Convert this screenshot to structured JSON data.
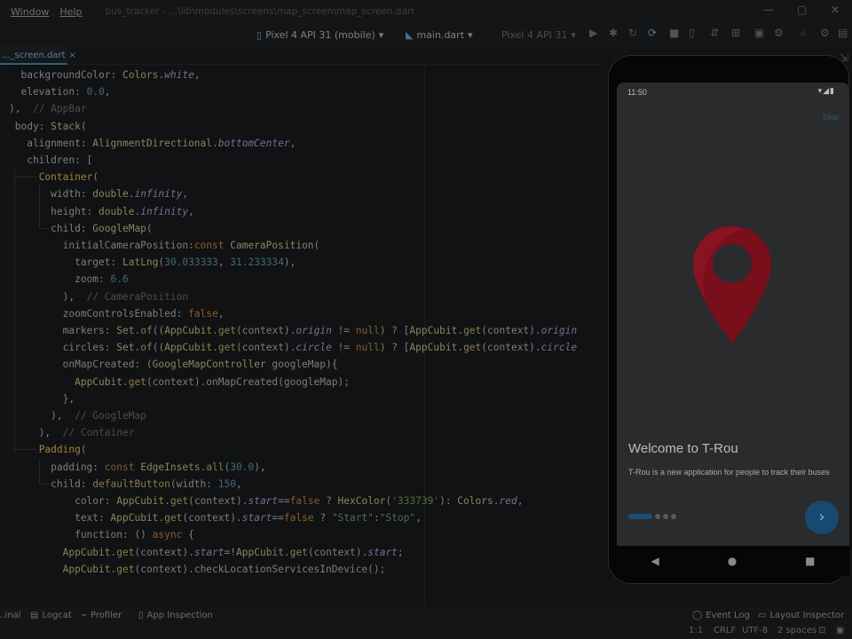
{
  "menu": {
    "window": "Window",
    "help": "Help",
    "path": "bus_tracker - ...\\lib\\modules\\screens\\map_screen\\map_screen.dart"
  },
  "toolbar": {
    "device": "Pixel 4 API 31 (mobile)",
    "config": "main.dart",
    "device2": "Pixel 4 API 31"
  },
  "tab": {
    "name": "..._screen.dart"
  },
  "code": [
    [
      [
        "t",
        "  backgroundColor: "
      ],
      [
        "cl",
        "Colors"
      ],
      [
        "t",
        "."
      ],
      [
        "pr",
        "white"
      ],
      [
        "t",
        ","
      ]
    ],
    [
      [
        "t",
        "  elevation: "
      ],
      [
        "nm",
        "0.0"
      ],
      [
        "t",
        ","
      ]
    ],
    [
      [
        "t",
        "),  "
      ],
      [
        "cm",
        "// AppBar"
      ]
    ],
    [
      [
        "t",
        " body: "
      ],
      [
        "cl",
        "Stack"
      ],
      [
        "t",
        "("
      ]
    ],
    [
      [
        "t",
        "   alignment: "
      ],
      [
        "cl",
        "AlignmentDirectional"
      ],
      [
        "t",
        "."
      ],
      [
        "pr",
        "bottomCenter"
      ],
      [
        "t",
        ","
      ]
    ],
    [
      [
        "t",
        "   children: ["
      ]
    ],
    [
      [
        "t",
        "     "
      ],
      [
        "tag",
        "Container"
      ],
      [
        "t",
        "("
      ]
    ],
    [
      [
        "t",
        "       width: "
      ],
      [
        "cl",
        "double"
      ],
      [
        "t",
        "."
      ],
      [
        "pr",
        "infinity"
      ],
      [
        "t",
        ","
      ]
    ],
    [
      [
        "t",
        "       height: "
      ],
      [
        "cl",
        "double"
      ],
      [
        "t",
        "."
      ],
      [
        "pr",
        "infinity"
      ],
      [
        "t",
        ","
      ]
    ],
    [
      [
        "t",
        "       child: "
      ],
      [
        "cl",
        "GoogleMap"
      ],
      [
        "t",
        "("
      ]
    ],
    [
      [
        "t",
        "         initialCameraPosition:"
      ],
      [
        "kw",
        "const "
      ],
      [
        "cl",
        "CameraPosition"
      ],
      [
        "t",
        "("
      ]
    ],
    [
      [
        "t",
        "           target: "
      ],
      [
        "cl",
        "LatLng"
      ],
      [
        "t",
        "("
      ],
      [
        "nm",
        "30.033333"
      ],
      [
        "t",
        ", "
      ],
      [
        "nm",
        "31.233334"
      ],
      [
        "t",
        "),"
      ]
    ],
    [
      [
        "t",
        "           zoom: "
      ],
      [
        "nm",
        "6.6"
      ]
    ],
    [
      [
        "t",
        "         ),  "
      ],
      [
        "cm",
        "// CameraPosition"
      ]
    ],
    [
      [
        "t",
        "         zoomControlsEnabled: "
      ],
      [
        "kw",
        "false"
      ],
      [
        "t",
        ","
      ]
    ],
    [
      [
        "t",
        "         markers: "
      ],
      [
        "cl",
        "Set"
      ],
      [
        "t",
        "."
      ],
      [
        "fn",
        "of"
      ],
      [
        "t",
        "(("
      ],
      [
        "cl",
        "AppCubit"
      ],
      [
        "t",
        "."
      ],
      [
        "fn",
        "get"
      ],
      [
        "t",
        "(context)."
      ],
      [
        "pr",
        "origin"
      ],
      [
        "t",
        " != "
      ],
      [
        "kw",
        "null"
      ],
      [
        "t",
        ") ? ["
      ],
      [
        "cl",
        "AppCubit"
      ],
      [
        "t",
        "."
      ],
      [
        "fn",
        "get"
      ],
      [
        "t",
        "(context)."
      ],
      [
        "pr",
        "origin"
      ]
    ],
    [
      [
        "t",
        "         circles: "
      ],
      [
        "cl",
        "Set"
      ],
      [
        "t",
        "."
      ],
      [
        "fn",
        "of"
      ],
      [
        "t",
        "(("
      ],
      [
        "cl",
        "AppCubit"
      ],
      [
        "t",
        "."
      ],
      [
        "fn",
        "get"
      ],
      [
        "t",
        "(context)."
      ],
      [
        "pr",
        "circle"
      ],
      [
        "t",
        " != "
      ],
      [
        "kw",
        "null"
      ],
      [
        "t",
        ") ? ["
      ],
      [
        "cl",
        "AppCubit"
      ],
      [
        "t",
        "."
      ],
      [
        "fn",
        "get"
      ],
      [
        "t",
        "(context)."
      ],
      [
        "pr",
        "circle"
      ]
    ],
    [
      [
        "t",
        "         onMapCreated: ("
      ],
      [
        "cl",
        "GoogleMapController"
      ],
      [
        "t",
        " googleMap)"
      ],
      [
        "t",
        "{"
      ]
    ],
    [
      [
        "t",
        "           "
      ],
      [
        "cl",
        "AppCubit"
      ],
      [
        "t",
        "."
      ],
      [
        "fn",
        "get"
      ],
      [
        "t",
        "(context).onMapCreated(googleMap);"
      ]
    ],
    [
      [
        "t",
        "         },"
      ]
    ],
    [
      [
        "t",
        "       ),  "
      ],
      [
        "cm",
        "// GoogleMap"
      ]
    ],
    [
      [
        "t",
        "     ),  "
      ],
      [
        "cm",
        "// Container"
      ]
    ],
    [
      [
        "t",
        "     "
      ],
      [
        "tag",
        "Padding"
      ],
      [
        "t",
        "("
      ]
    ],
    [
      [
        "t",
        "       padding: "
      ],
      [
        "kw",
        "const "
      ],
      [
        "cl",
        "EdgeInsets"
      ],
      [
        "t",
        "."
      ],
      [
        "fn",
        "all"
      ],
      [
        "t",
        "("
      ],
      [
        "nm",
        "30.0"
      ],
      [
        "t",
        "),"
      ]
    ],
    [
      [
        "t",
        "       child: "
      ],
      [
        "fn",
        "defaultButton"
      ],
      [
        "t",
        "(width: "
      ],
      [
        "nm",
        "150"
      ],
      [
        "t",
        ","
      ]
    ],
    [
      [
        "t",
        "           color: "
      ],
      [
        "cl",
        "AppCubit"
      ],
      [
        "t",
        "."
      ],
      [
        "fn",
        "get"
      ],
      [
        "t",
        "(context)."
      ],
      [
        "pr",
        "start"
      ],
      [
        "t",
        "=="
      ],
      [
        "kw",
        "false"
      ],
      [
        "t",
        " ? "
      ],
      [
        "cl",
        "HexColor"
      ],
      [
        "t",
        "("
      ],
      [
        "st",
        "'333739'"
      ],
      [
        "t",
        "): "
      ],
      [
        "cl",
        "Colors"
      ],
      [
        "t",
        "."
      ],
      [
        "pr",
        "red"
      ],
      [
        "t",
        ","
      ]
    ],
    [
      [
        "t",
        "           text: "
      ],
      [
        "cl",
        "AppCubit"
      ],
      [
        "t",
        "."
      ],
      [
        "fn",
        "get"
      ],
      [
        "t",
        "(context)."
      ],
      [
        "pr",
        "start"
      ],
      [
        "t",
        "=="
      ],
      [
        "kw",
        "false"
      ],
      [
        "t",
        " ? "
      ],
      [
        "st",
        "\"Start\""
      ],
      [
        "t",
        ":"
      ],
      [
        "st",
        "\"Stop\""
      ],
      [
        "t",
        ","
      ]
    ],
    [
      [
        "t",
        "           function: () "
      ],
      [
        "kw",
        "async"
      ],
      [
        "t",
        " {"
      ]
    ],
    [
      [
        "t",
        "         "
      ],
      [
        "cl",
        "AppCubit"
      ],
      [
        "t",
        "."
      ],
      [
        "fn",
        "get"
      ],
      [
        "t",
        "(context)."
      ],
      [
        "pr",
        "start"
      ],
      [
        "t",
        "=!"
      ],
      [
        "cl",
        "AppCubit"
      ],
      [
        "t",
        "."
      ],
      [
        "fn",
        "get"
      ],
      [
        "t",
        "(context)."
      ],
      [
        "pr",
        "start"
      ],
      [
        "t",
        ";"
      ]
    ],
    [
      [
        "t",
        "         "
      ],
      [
        "cl",
        "AppCubit"
      ],
      [
        "t",
        "."
      ],
      [
        "fn",
        "get"
      ],
      [
        "t",
        "(context).checkLocationServicesInDevice();"
      ]
    ]
  ],
  "phone": {
    "time": "11:50",
    "skip": "Skip",
    "welcome_title": "Welcome to T-Rou",
    "welcome_sub": "T-Rou is a new application for people to track their buses",
    "page_index": 1,
    "page_count": 4
  },
  "bottom": {
    "terminal": "...inal",
    "logcat": "Logcat",
    "profiler": "Profiler",
    "app_inspection": "App Inspection",
    "event_log": "Event Log",
    "layout_inspector": "Layout Inspector"
  },
  "status": {
    "position": "1:1",
    "line_sep": "CRLF",
    "encoding": "UTF-8",
    "indent": "2 spaces"
  },
  "colors": {
    "accent": "#1d4e73",
    "pin": "#7a0f1c"
  }
}
